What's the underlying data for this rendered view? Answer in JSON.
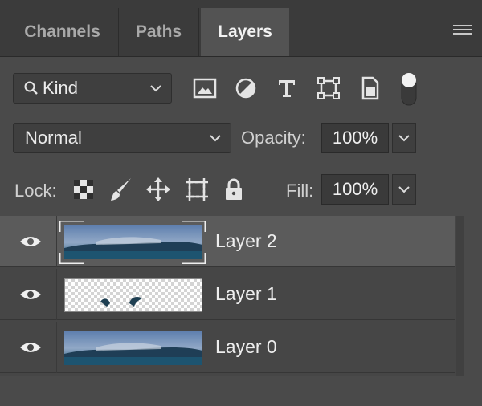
{
  "tabs": [
    {
      "label": "Channels",
      "active": false
    },
    {
      "label": "Paths",
      "active": false
    },
    {
      "label": "Layers",
      "active": true
    }
  ],
  "filter": {
    "kind_label": "Kind",
    "icons": [
      "image-filter-icon",
      "adjustment-filter-icon",
      "type-filter-icon",
      "shape-filter-icon",
      "smart-object-filter-icon"
    ]
  },
  "blend": {
    "mode": "Normal",
    "opacity_label": "Opacity:",
    "opacity_value": "100%"
  },
  "lock": {
    "label": "Lock:",
    "icons": [
      "lock-transparent-pixels-icon",
      "lock-image-pixels-icon",
      "lock-position-icon",
      "lock-artboard-icon",
      "lock-all-icon"
    ],
    "fill_label": "Fill:",
    "fill_value": "100%"
  },
  "layers": [
    {
      "name": "Layer 2",
      "visible": true,
      "selected": true
    },
    {
      "name": "Layer 1",
      "visible": true,
      "selected": false
    },
    {
      "name": "Layer 0",
      "visible": true,
      "selected": false
    }
  ],
  "colors": {
    "panel_bg": "#4a4a4a",
    "selected_row": "#5b5b5b",
    "text": "#eeeeee"
  }
}
